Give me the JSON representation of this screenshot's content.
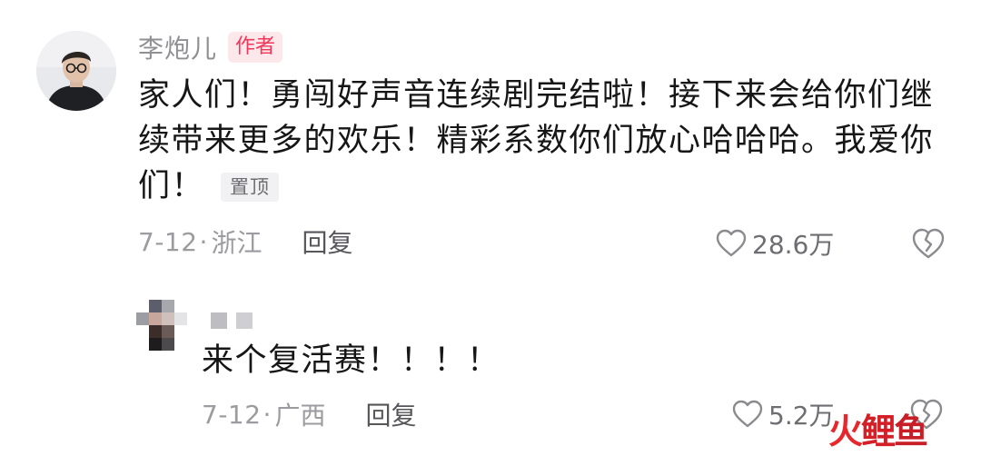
{
  "comment": {
    "author": "李炮儿",
    "author_badge": "作者",
    "text": "家人们！勇闯好声音连续剧完结啦！接下来会给你们继续带来更多的欢乐！精彩系数你们放心哈哈哈。我爱你们！",
    "pin_badge": "置顶",
    "date": "7-12",
    "location": "浙江",
    "reply_label": "回复",
    "like_count": "28.6万"
  },
  "reply": {
    "text": "来个复活赛！！！！",
    "date": "7-12",
    "location": "广西",
    "reply_label": "回复",
    "like_count": "5.2万"
  },
  "separator": "·",
  "icons": {
    "like": "heart-outline-icon",
    "dislike": "broken-heart-icon"
  },
  "watermark": {
    "char1": "火",
    "char2": "鲤",
    "char3": "鱼"
  },
  "colors": {
    "author_badge_text": "#f0385b",
    "author_badge_bg": "#fce7ea",
    "secondary_text": "#9b9ba0",
    "primary_text": "#161616",
    "watermark": "#e8272c"
  }
}
